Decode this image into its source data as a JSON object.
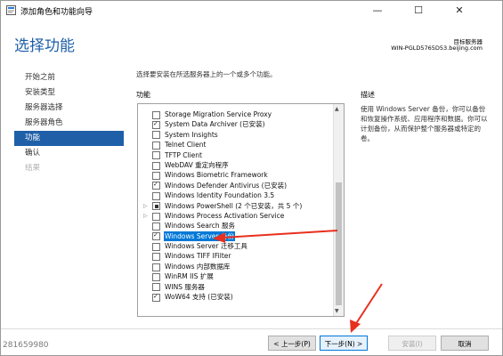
{
  "window": {
    "title": "添加角色和功能向导",
    "minimize": "—",
    "maximize": "☐",
    "close": "✕"
  },
  "header": {
    "page_title": "选择功能",
    "dest_label": "目标服务器",
    "dest_server": "WIN-PGLD5765D53.beijing.com"
  },
  "nav": {
    "items": [
      {
        "label": "开始之前",
        "state": "normal"
      },
      {
        "label": "安装类型",
        "state": "normal"
      },
      {
        "label": "服务器选择",
        "state": "normal"
      },
      {
        "label": "服务器角色",
        "state": "normal"
      },
      {
        "label": "功能",
        "state": "active"
      },
      {
        "label": "确认",
        "state": "normal"
      },
      {
        "label": "结果",
        "state": "disabled"
      }
    ]
  },
  "main": {
    "instruction": "选择要安装在所选服务器上的一个或多个功能。",
    "features_header": "功能",
    "description_header": "描述",
    "description_text": "使用 Windows Server 备份，你可以备份和恢复操作系统、应用程序和数据。你可以计划备份，从而保护整个服务器或特定的卷。",
    "features": [
      {
        "label": "Storage Migration Service Proxy",
        "state": "unchecked",
        "expandable": false,
        "selected": false
      },
      {
        "label": "System Data Archiver (已安装)",
        "state": "checked",
        "expandable": false,
        "selected": false
      },
      {
        "label": "System Insights",
        "state": "unchecked",
        "expandable": false,
        "selected": false
      },
      {
        "label": "Telnet Client",
        "state": "unchecked",
        "expandable": false,
        "selected": false
      },
      {
        "label": "TFTP Client",
        "state": "unchecked",
        "expandable": false,
        "selected": false
      },
      {
        "label": "WebDAV 重定向程序",
        "state": "unchecked",
        "expandable": false,
        "selected": false
      },
      {
        "label": "Windows Biometric Framework",
        "state": "unchecked",
        "expandable": false,
        "selected": false
      },
      {
        "label": "Windows Defender Antivirus (已安装)",
        "state": "checked",
        "expandable": false,
        "selected": false
      },
      {
        "label": "Windows Identity Foundation 3.5",
        "state": "unchecked",
        "expandable": false,
        "selected": false
      },
      {
        "label": "Windows PowerShell (2 个已安装，共 5 个)",
        "state": "partial",
        "expandable": true,
        "selected": false
      },
      {
        "label": "Windows Process Activation Service",
        "state": "unchecked",
        "expandable": true,
        "selected": false
      },
      {
        "label": "Windows Search 服务",
        "state": "unchecked",
        "expandable": false,
        "selected": false
      },
      {
        "label": "Windows Server 备份",
        "state": "checked",
        "expandable": false,
        "selected": true
      },
      {
        "label": "Windows Server 迁移工具",
        "state": "unchecked",
        "expandable": false,
        "selected": false
      },
      {
        "label": "Windows TIFF IFilter",
        "state": "unchecked",
        "expandable": false,
        "selected": false
      },
      {
        "label": "Windows 内部数据库",
        "state": "unchecked",
        "expandable": false,
        "selected": false
      },
      {
        "label": "WinRM IIS 扩展",
        "state": "unchecked",
        "expandable": false,
        "selected": false
      },
      {
        "label": "WINS 服务器",
        "state": "unchecked",
        "expandable": false,
        "selected": false
      },
      {
        "label": "WoW64 支持 (已安装)",
        "state": "checked",
        "expandable": false,
        "selected": false
      }
    ]
  },
  "footer": {
    "prev": "< 上一步(P)",
    "next": "下一步(N) >",
    "install": "安装(I)",
    "cancel": "取消"
  },
  "watermark": "281659980",
  "colors": {
    "accent": "#1e5fa8",
    "selection": "#0078d7",
    "annotation": "#e8301e"
  }
}
